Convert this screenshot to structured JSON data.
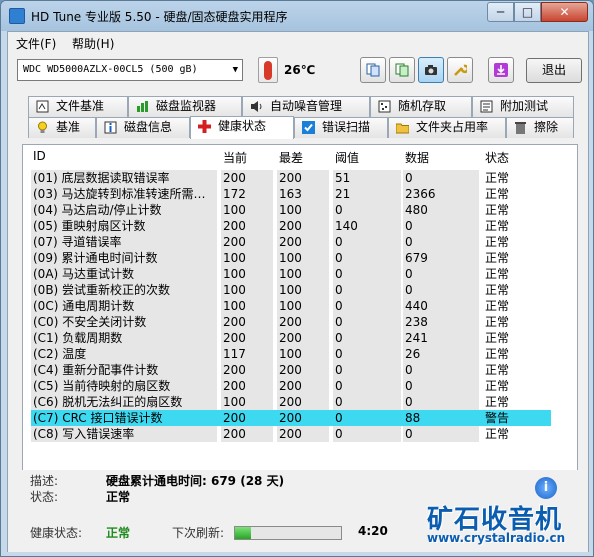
{
  "window": {
    "title": "HD Tune 专业版 5.50 - 硬盘/固态硬盘实用程序",
    "min_label": "─",
    "max_label": "□",
    "close_label": "✕"
  },
  "menu": [
    {
      "label": "文件(F)"
    },
    {
      "label": "帮助(H)"
    }
  ],
  "toolbar": {
    "drive": "WDC WD5000AZLX-00CL5 (500 gB)",
    "temperature": "26℃",
    "buttons": [
      {
        "icon": "copy-text-icon"
      },
      {
        "icon": "copy-screen-icon"
      },
      {
        "icon": "screenshot-camera-icon",
        "active": true
      },
      {
        "icon": "options-wrench-icon"
      },
      {
        "icon": "save-download-icon"
      }
    ],
    "exit_label": "退出"
  },
  "tabs_top": [
    {
      "label": "文件基准",
      "icon": "file-benchmark-icon"
    },
    {
      "label": "磁盘监视器",
      "icon": "disk-monitor-icon"
    },
    {
      "label": "自动噪音管理",
      "icon": "speaker-icon"
    },
    {
      "label": "随机存取",
      "icon": "random-access-icon"
    },
    {
      "label": "附加测试",
      "icon": "extra-tests-icon"
    }
  ],
  "tabs_bottom": [
    {
      "label": "基准",
      "icon": "lightbulb-icon"
    },
    {
      "label": "磁盘信息",
      "icon": "disk-info-icon"
    },
    {
      "label": "健康状态",
      "icon": "health-cross-icon",
      "active": true
    },
    {
      "label": "错误扫描",
      "icon": "error-scan-icon"
    },
    {
      "label": "文件夹占用率",
      "icon": "folder-icon"
    },
    {
      "label": "擦除",
      "icon": "trash-icon"
    }
  ],
  "health_table": {
    "columns": [
      "ID",
      "当前",
      "最差",
      "阈值",
      "数据",
      "状态"
    ],
    "rows": [
      {
        "id": "(01) 底层数据读取错误率",
        "current": "200",
        "worst": "200",
        "threshold": "51",
        "data": "0",
        "status": "正常"
      },
      {
        "id": "(03) 马达旋转到标准转速所需…",
        "current": "172",
        "worst": "163",
        "threshold": "21",
        "data": "2366",
        "status": "正常"
      },
      {
        "id": "(04) 马达启动/停止计数",
        "current": "100",
        "worst": "100",
        "threshold": "0",
        "data": "480",
        "status": "正常"
      },
      {
        "id": "(05) 重映射扇区计数",
        "current": "200",
        "worst": "200",
        "threshold": "140",
        "data": "0",
        "status": "正常"
      },
      {
        "id": "(07) 寻道错误率",
        "current": "200",
        "worst": "200",
        "threshold": "0",
        "data": "0",
        "status": "正常"
      },
      {
        "id": "(09) 累计通电时间计数",
        "current": "100",
        "worst": "100",
        "threshold": "0",
        "data": "679",
        "status": "正常"
      },
      {
        "id": "(0A) 马达重试计数",
        "current": "100",
        "worst": "100",
        "threshold": "0",
        "data": "0",
        "status": "正常"
      },
      {
        "id": "(0B) 尝试重新校正的次数",
        "current": "100",
        "worst": "100",
        "threshold": "0",
        "data": "0",
        "status": "正常"
      },
      {
        "id": "(0C) 通电周期计数",
        "current": "100",
        "worst": "100",
        "threshold": "0",
        "data": "440",
        "status": "正常"
      },
      {
        "id": "(C0) 不安全关闭计数",
        "current": "200",
        "worst": "200",
        "threshold": "0",
        "data": "238",
        "status": "正常"
      },
      {
        "id": "(C1) 负载周期数",
        "current": "200",
        "worst": "200",
        "threshold": "0",
        "data": "241",
        "status": "正常"
      },
      {
        "id": "(C2) 温度",
        "current": "117",
        "worst": "100",
        "threshold": "0",
        "data": "26",
        "status": "正常"
      },
      {
        "id": "(C4) 重新分配事件计数",
        "current": "200",
        "worst": "200",
        "threshold": "0",
        "data": "0",
        "status": "正常"
      },
      {
        "id": "(C5) 当前待映射的扇区数",
        "current": "200",
        "worst": "200",
        "threshold": "0",
        "data": "0",
        "status": "正常"
      },
      {
        "id": "(C6) 脱机无法纠正的扇区数",
        "current": "100",
        "worst": "200",
        "threshold": "0",
        "data": "0",
        "status": "正常"
      },
      {
        "id": "(C7) CRC 接口错误计数",
        "current": "200",
        "worst": "200",
        "threshold": "0",
        "data": "88",
        "status": "警告",
        "highlight": true
      },
      {
        "id": "(C8) 写入错误速率",
        "current": "200",
        "worst": "200",
        "threshold": "0",
        "data": "0",
        "status": "正常"
      }
    ]
  },
  "info": {
    "desc_label": "描述:",
    "desc_value": "硬盘累计通电时间: 679 (28 天)",
    "status_label": "状态:",
    "status_value": "正常",
    "health_label": "健康状态:",
    "health_value": "正常",
    "next_refresh_label": "下次刷新:",
    "countdown": "4:20",
    "refresh_progress": 0.15
  },
  "watermark": {
    "text": "矿石收音机",
    "url": "www.crystalradio.cn",
    "info_glyph": "i"
  },
  "colors": {
    "warning_row": "#3dd9f0",
    "health_ok": "#1f8a1f"
  }
}
